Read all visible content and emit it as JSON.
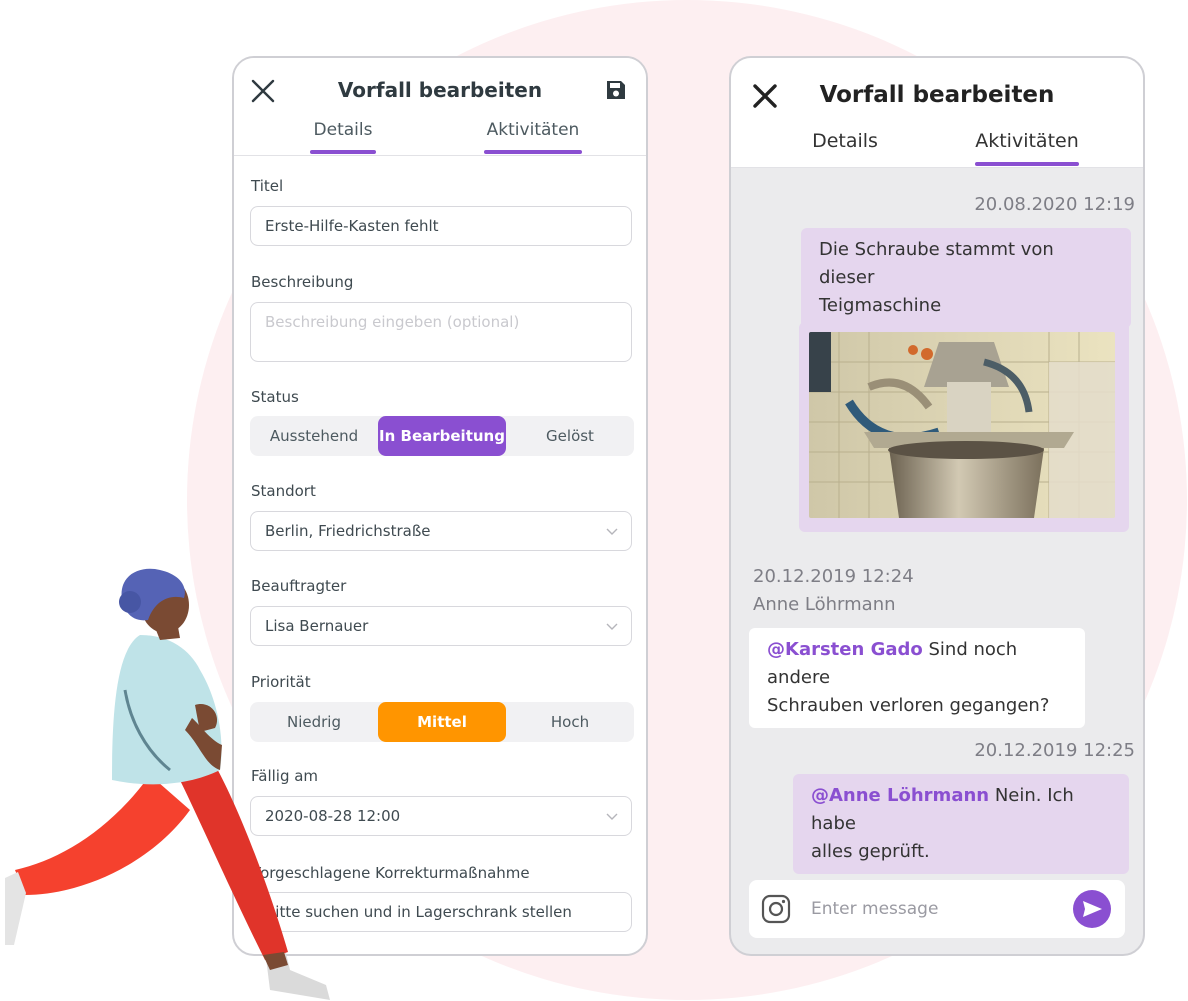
{
  "colors": {
    "accent": "#8a4fd1",
    "priority_active": "#ff9500",
    "bubble_me": "#e5d6ee",
    "background_circle": "#fdeff1"
  },
  "left_screen": {
    "title": "Vorfall bearbeiten",
    "tabs": [
      "Details",
      "Aktivitäten"
    ],
    "fields": {
      "title_label": "Titel",
      "title_value": "Erste-Hilfe-Kasten fehlt",
      "description_label": "Beschreibung",
      "description_placeholder": "Beschreibung eingeben (optional)",
      "status_label": "Status",
      "status_options": [
        "Ausstehend",
        "In Bearbeitung",
        "Gelöst"
      ],
      "status_selected": "In Bearbeitung",
      "location_label": "Standort",
      "location_value": "Berlin, Friedrichstraße",
      "assignee_label": "Beauftragter",
      "assignee_value": "Lisa Bernauer",
      "priority_label": "Priorität",
      "priority_options": [
        "Niedrig",
        "Mittel",
        "Hoch"
      ],
      "priority_selected": "Mittel",
      "due_label": "Fällig am",
      "due_value": "2020-08-28 12:00",
      "correction_label": "Vorgeschlagene Korrekturmaßnahme",
      "correction_value": "Bitte suchen und in Lagerschrank stellen"
    }
  },
  "right_screen": {
    "title": "Vorfall bearbeiten",
    "tabs": [
      "Details",
      "Aktivitäten"
    ],
    "messages": [
      {
        "timestamp": "20.08.2020 12:19",
        "text_line1": "Die Schraube stammt von dieser",
        "text_line2": "Teigmaschine"
      },
      {
        "timestamp": "20.12.2019 12:24",
        "author": "Anne Löhrmann",
        "mention": "@Karsten Gado",
        "text_line1": " Sind noch andere",
        "text_line2": "Schrauben verloren gegangen?"
      },
      {
        "timestamp": "20.12.2019 12:25",
        "mention": "@Anne Löhrmann",
        "text_line1": " Nein. Ich habe",
        "text_line2": "alles geprüft."
      }
    ],
    "composer_placeholder": "Enter message"
  }
}
